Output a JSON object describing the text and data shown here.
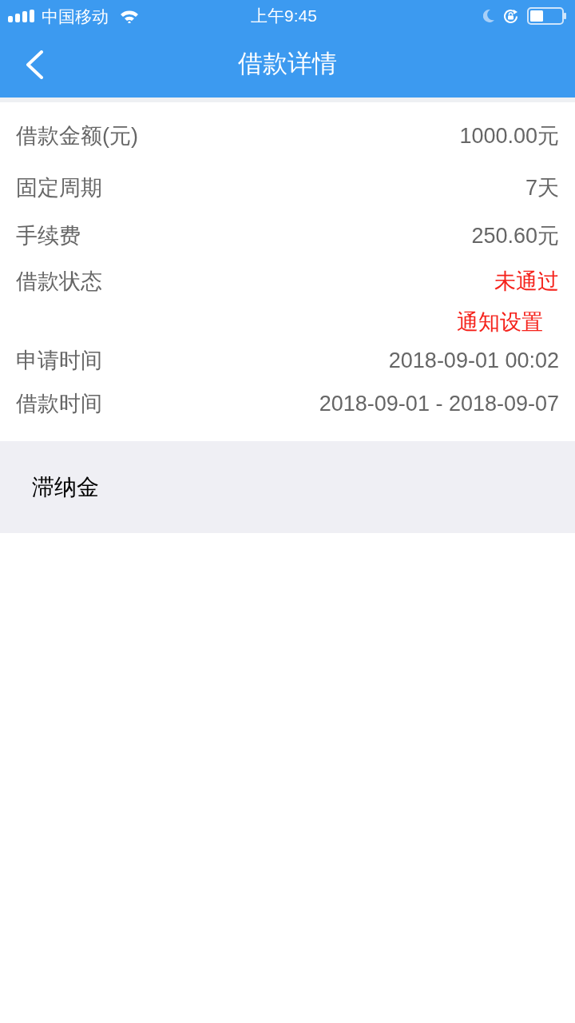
{
  "status_bar": {
    "carrier": "中国移动",
    "time": "上午9:45"
  },
  "nav_bar": {
    "title": "借款详情"
  },
  "details": [
    {
      "kind": "plain",
      "label": "借款金额(元)",
      "value": "1000.00元"
    },
    {
      "kind": "plain",
      "label": "固定周期",
      "value": "7天"
    },
    {
      "kind": "plain",
      "label": "手续费",
      "value": "250.60元"
    },
    {
      "kind": "status",
      "label": "借款状态",
      "value": "未通过",
      "action": "通知设置"
    },
    {
      "kind": "plain",
      "label": "申请时间",
      "value": "2018-09-01 00:02"
    },
    {
      "kind": "plain",
      "label": "借款时间",
      "value": "2018-09-01 - 2018-09-07"
    }
  ],
  "section": {
    "title": "滞纳金"
  }
}
